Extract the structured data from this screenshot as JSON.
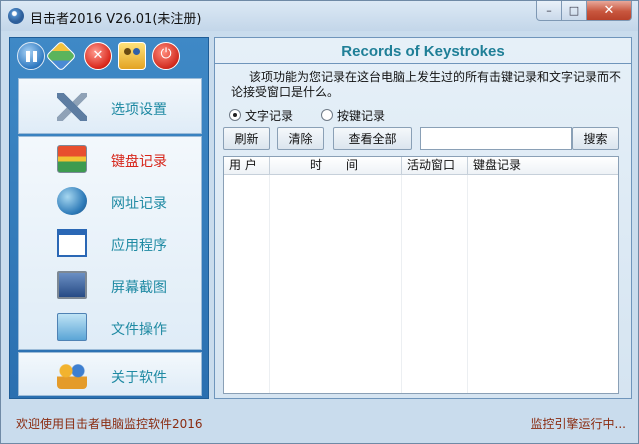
{
  "window": {
    "title": "目击者2016 V26.01(未注册)",
    "controls": {
      "minimize": "–",
      "maximize": "□",
      "close": "✕"
    }
  },
  "toolbar": {
    "icons": [
      "pause-icon",
      "app-settings-icon",
      "stop-icon",
      "users-icon",
      "power-icon"
    ]
  },
  "sidebar": {
    "settings": {
      "label": "选项设置",
      "icon": "wrench-icon"
    },
    "items": [
      {
        "label": "键盘记录",
        "icon": "keyboard-icon",
        "active": true
      },
      {
        "label": "网址记录",
        "icon": "globe-icon",
        "active": false
      },
      {
        "label": "应用程序",
        "icon": "window-icon",
        "active": false
      },
      {
        "label": "屏幕截图",
        "icon": "monitor-icon",
        "active": false
      },
      {
        "label": "文件操作",
        "icon": "files-icon",
        "active": false
      }
    ],
    "about": {
      "label": "关于软件",
      "icon": "people-icon"
    }
  },
  "main": {
    "title": "Records of Keystrokes",
    "description": "该项功能为您记录在这台电脑上发生过的所有击键记录和文字记录而不论接受窗口是什么。",
    "radios": [
      {
        "label": "文字记录",
        "checked": true
      },
      {
        "label": "按键记录",
        "checked": false
      }
    ],
    "buttons": {
      "refresh": "刷新",
      "clear": "清除",
      "view_all": "查看全部",
      "search": "搜索"
    },
    "search_value": "",
    "table": {
      "columns": [
        "用 户",
        "时　　间",
        "活动窗口",
        "键盘记录"
      ],
      "rows": []
    }
  },
  "status": {
    "left": "欢迎使用目击者电脑监控软件2016",
    "right": "监控引擎运行中..."
  },
  "colors": {
    "accent": "#1f8aa3",
    "active": "#d7261b",
    "sidebar": "#2f76b6",
    "status": "#8a2b10"
  }
}
